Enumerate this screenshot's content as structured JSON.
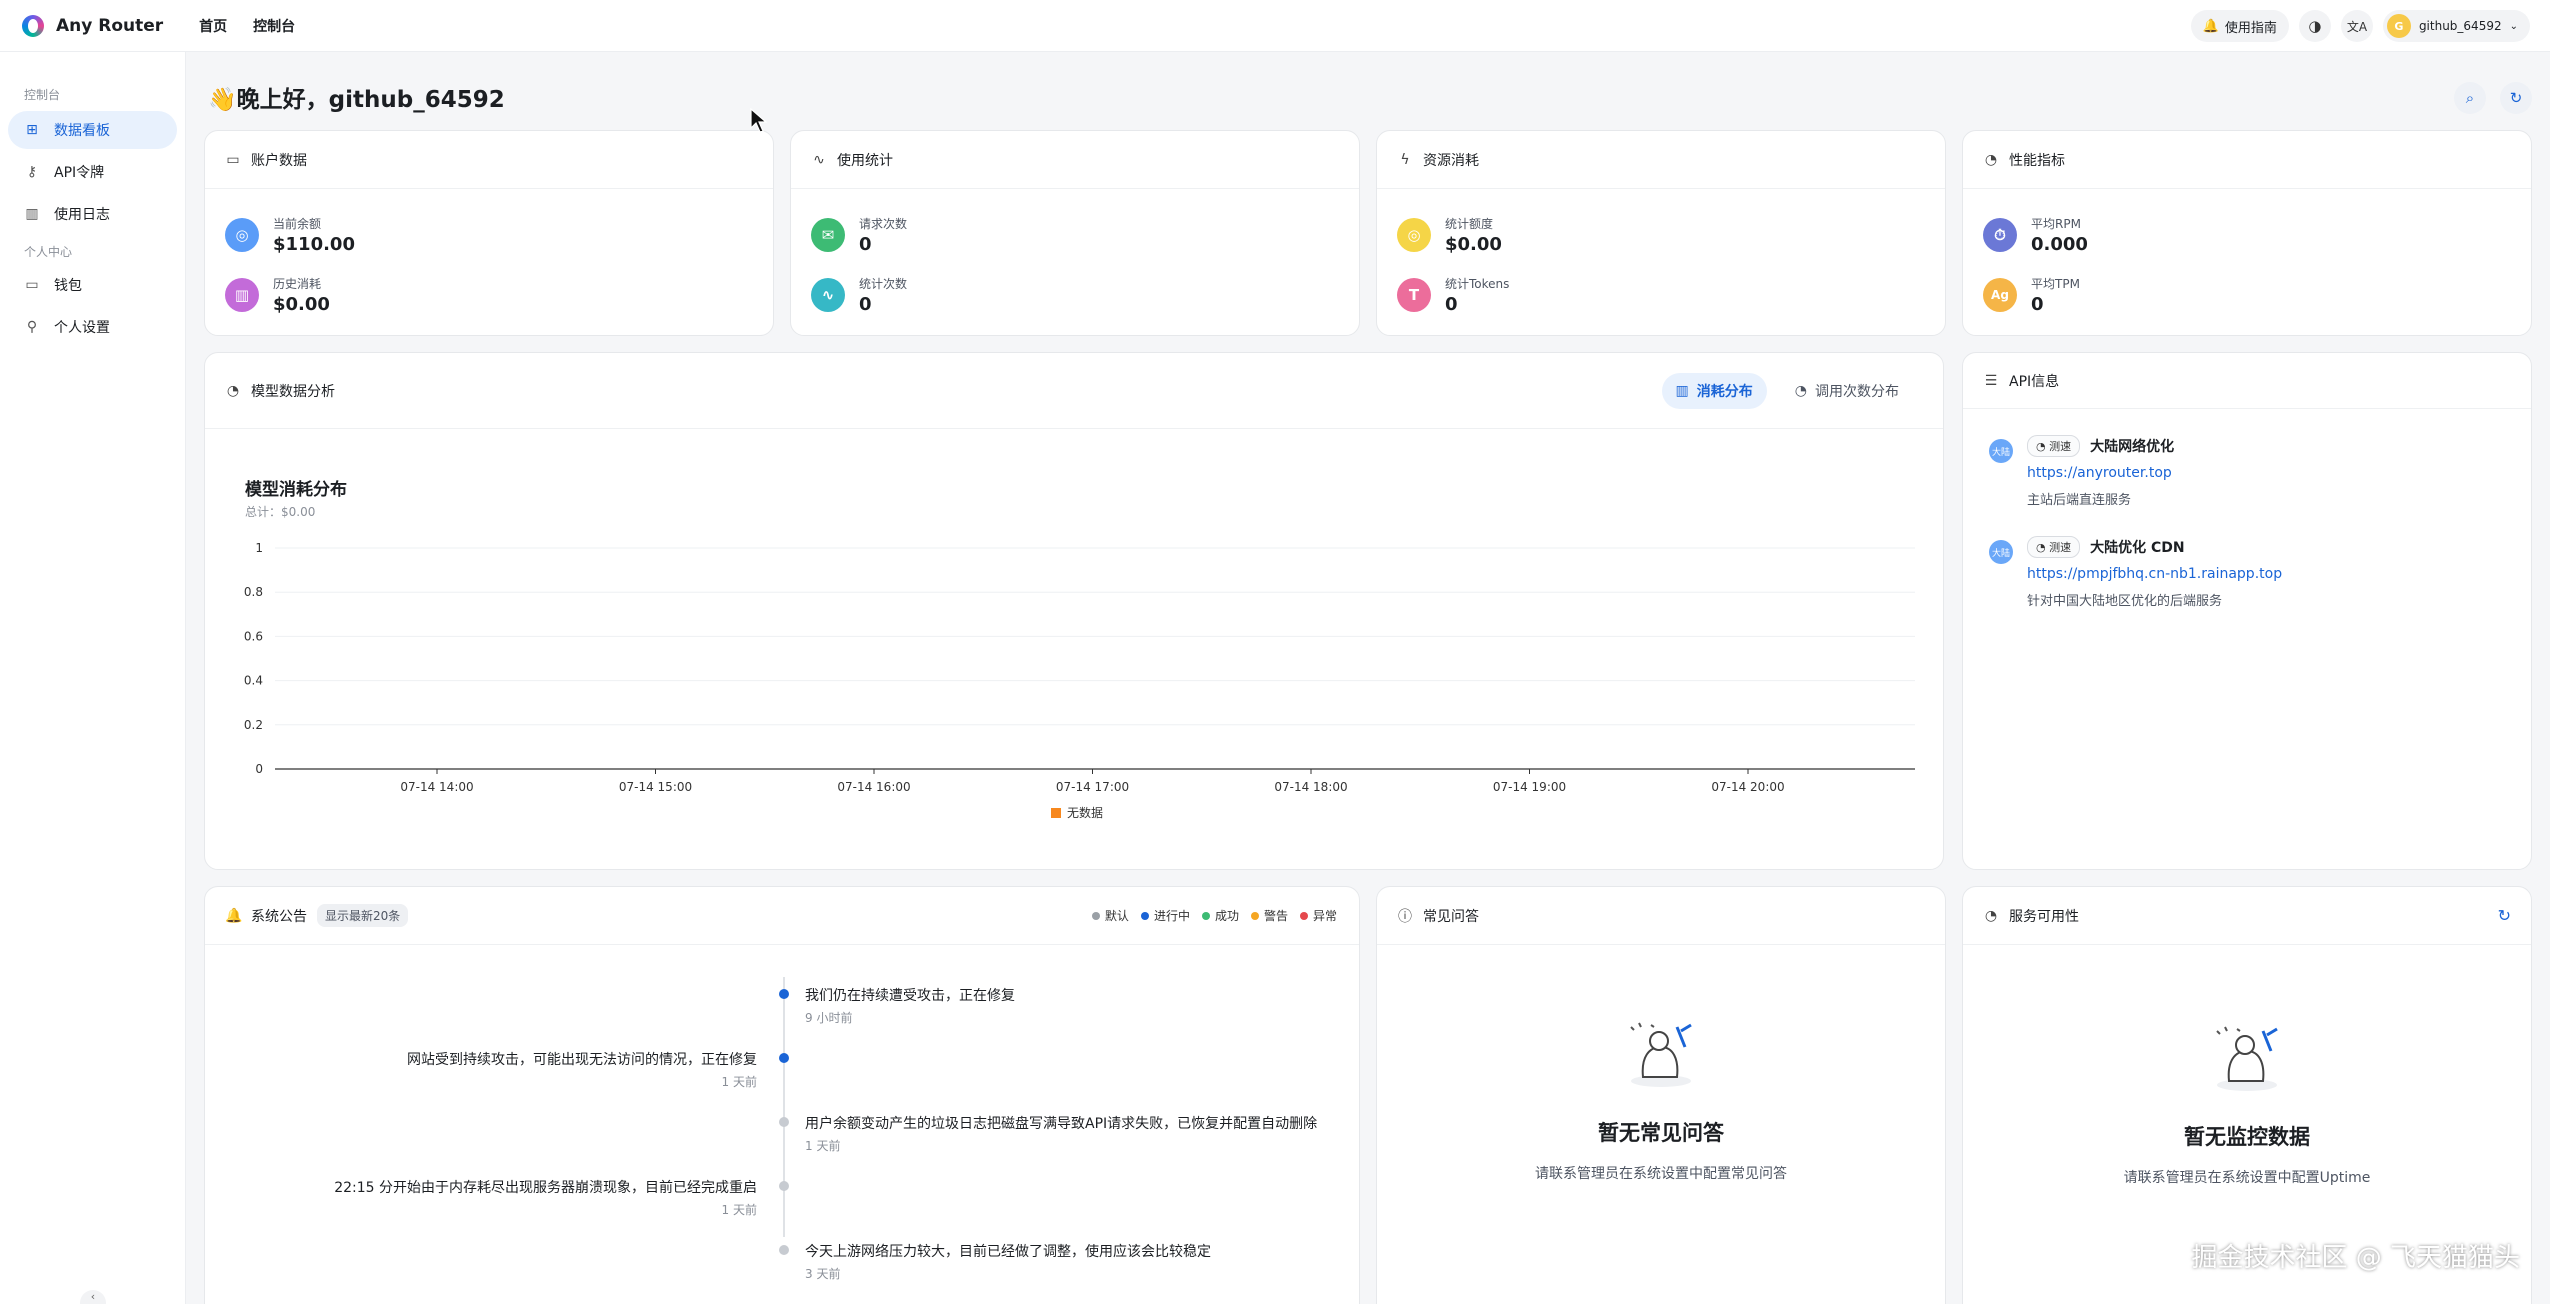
{
  "topbar": {
    "brand": "Any Router",
    "nav": [
      "首页",
      "控制台"
    ],
    "guide_label": "使用指南",
    "username": "github_64592",
    "avatar_letter": "G"
  },
  "sidebar": {
    "section1": "控制台",
    "items1": [
      {
        "label": "数据看板",
        "icon": "dashboard-icon"
      },
      {
        "label": "API令牌",
        "icon": "key-icon"
      },
      {
        "label": "使用日志",
        "icon": "chart-bar-icon"
      }
    ],
    "section2": "个人中心",
    "items2": [
      {
        "label": "钱包",
        "icon": "wallet-icon"
      },
      {
        "label": "个人设置",
        "icon": "user-icon"
      }
    ]
  },
  "greeting": "👋晚上好，github_64592",
  "cards": {
    "account": {
      "title": "账户数据",
      "stats": [
        {
          "label": "当前余额",
          "value": "$110.00",
          "color": "#5a9cf8"
        },
        {
          "label": "历史消耗",
          "value": "$0.00",
          "color": "#c36bd9"
        }
      ]
    },
    "usage": {
      "title": "使用统计",
      "stats": [
        {
          "label": "请求次数",
          "value": "0",
          "color": "#3dbb74"
        },
        {
          "label": "统计次数",
          "value": "0",
          "color": "#36b8c6"
        }
      ]
    },
    "resource": {
      "title": "资源消耗",
      "stats": [
        {
          "label": "统计额度",
          "value": "$0.00",
          "color": "#f5d547"
        },
        {
          "label": "统计Tokens",
          "value": "0",
          "color": "#ec6d9b"
        }
      ]
    },
    "performance": {
      "title": "性能指标",
      "stats": [
        {
          "label": "平均RPM",
          "value": "0.000",
          "color": "#6b78d6"
        },
        {
          "label": "平均TPM",
          "value": "0",
          "color": "#f5b547"
        }
      ]
    }
  },
  "model": {
    "title": "模型数据分析",
    "tab_active": "消耗分布",
    "tab_other": "调用次数分布"
  },
  "chart_data": {
    "type": "bar",
    "title": "模型消耗分布",
    "subtitle": "总计：$0.00",
    "categories": [
      "07-14 14:00",
      "07-14 15:00",
      "07-14 16:00",
      "07-14 17:00",
      "07-14 18:00",
      "07-14 19:00",
      "07-14 20:00"
    ],
    "series": [
      {
        "name": "无数据",
        "values": [
          0,
          0,
          0,
          0,
          0,
          0,
          0
        ],
        "color": "#f7881e"
      }
    ],
    "yticks": [
      "0",
      "0.2",
      "0.4",
      "0.6",
      "0.8",
      "1"
    ],
    "ylim": [
      0,
      1
    ],
    "legend": "bottom-center"
  },
  "api": {
    "title": "API信息",
    "items": [
      {
        "badge": "大陆",
        "speed": "测速",
        "name": "大陆网络优化",
        "url": "https://anyrouter.top",
        "desc": "主站后端直连服务"
      },
      {
        "badge": "大陆",
        "speed": "测速",
        "name": "大陆优化 CDN",
        "url": "https://pmpjfbhq.cn-nb1.rainapp.top",
        "desc": "针对中国大陆地区优化的后端服务"
      }
    ]
  },
  "announcements": {
    "title": "系统公告",
    "tag": "显示最新20条",
    "legend": [
      {
        "label": "默认",
        "color": "#9aa0a6"
      },
      {
        "label": "进行中",
        "color": "#1a64d6"
      },
      {
        "label": "成功",
        "color": "#3dbb74"
      },
      {
        "label": "警告",
        "color": "#f5a623"
      },
      {
        "label": "异常",
        "color": "#e5484d"
      }
    ],
    "items": [
      {
        "text": "我们仍在持续遭受攻击，正在修复",
        "time": "9 小时前"
      },
      {
        "text": "网站受到持续攻击，可能出现无法访问的情况，正在修复",
        "time": "1 天前"
      },
      {
        "text": "用户余额变动产生的垃圾日志把磁盘写满导致API请求失败，已恢复并配置自动删除",
        "time": "1 天前"
      },
      {
        "text": "22:15 分开始由于内存耗尽出现服务器崩溃现象，目前已经完成重启",
        "time": "1 天前"
      },
      {
        "text": "今天上游网络压力较大，目前已经做了调整，使用应该会比较稳定",
        "time": "3 天前"
      }
    ]
  },
  "faq": {
    "title": "常见问答",
    "empty_title": "暂无常见问答",
    "empty_sub": "请联系管理员在系统设置中配置常见问答"
  },
  "uptime": {
    "title": "服务可用性",
    "empty_title": "暂无监控数据",
    "empty_sub": "请联系管理员在系统设置中配置Uptime"
  },
  "watermark": "掘金技术社区 @ 飞天猫猫头"
}
